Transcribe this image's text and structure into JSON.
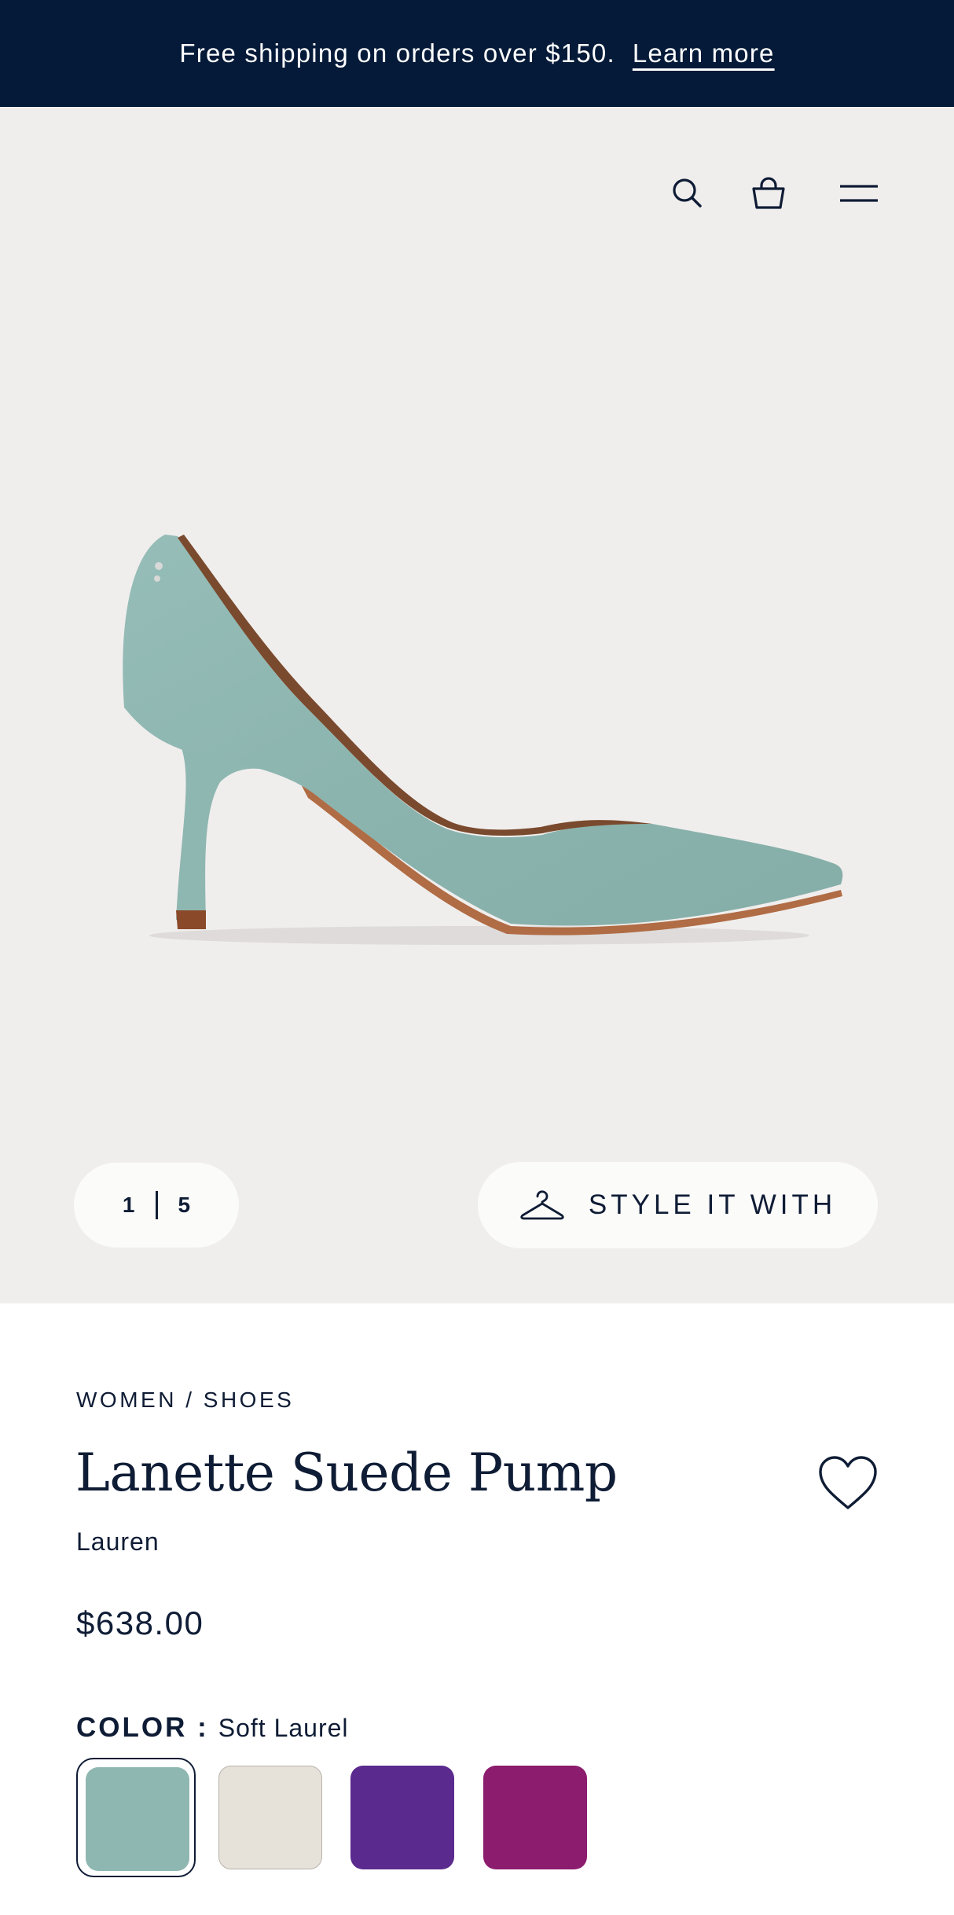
{
  "promo": {
    "text": "Free shipping on orders over $150.",
    "link": "Learn more"
  },
  "header": {
    "icons": [
      "search-icon",
      "shopping-bag-icon",
      "menu-icon"
    ]
  },
  "gallery": {
    "current": "1",
    "total": "5",
    "style_button": "STYLE IT WITH"
  },
  "product": {
    "breadcrumb": "WOMEN / SHOES",
    "name": "Lanette Suede Pump",
    "brand": "Lauren",
    "price": "$638.00",
    "color_label": "COLOR :",
    "color_value": "Soft Laurel",
    "swatches": [
      {
        "color": "#8fb7b1",
        "selected": true
      },
      {
        "color": "#e6e1d9",
        "selected": false
      },
      {
        "color": "#5b2a8e",
        "selected": false
      },
      {
        "color": "#8b1c6e",
        "selected": false
      }
    ]
  },
  "colors": {
    "navy": "#041a38",
    "text": "#0f1c35",
    "hero_bg": "#f0eeed",
    "shoe": "#8fb7b1",
    "sole": "#b06c45"
  }
}
